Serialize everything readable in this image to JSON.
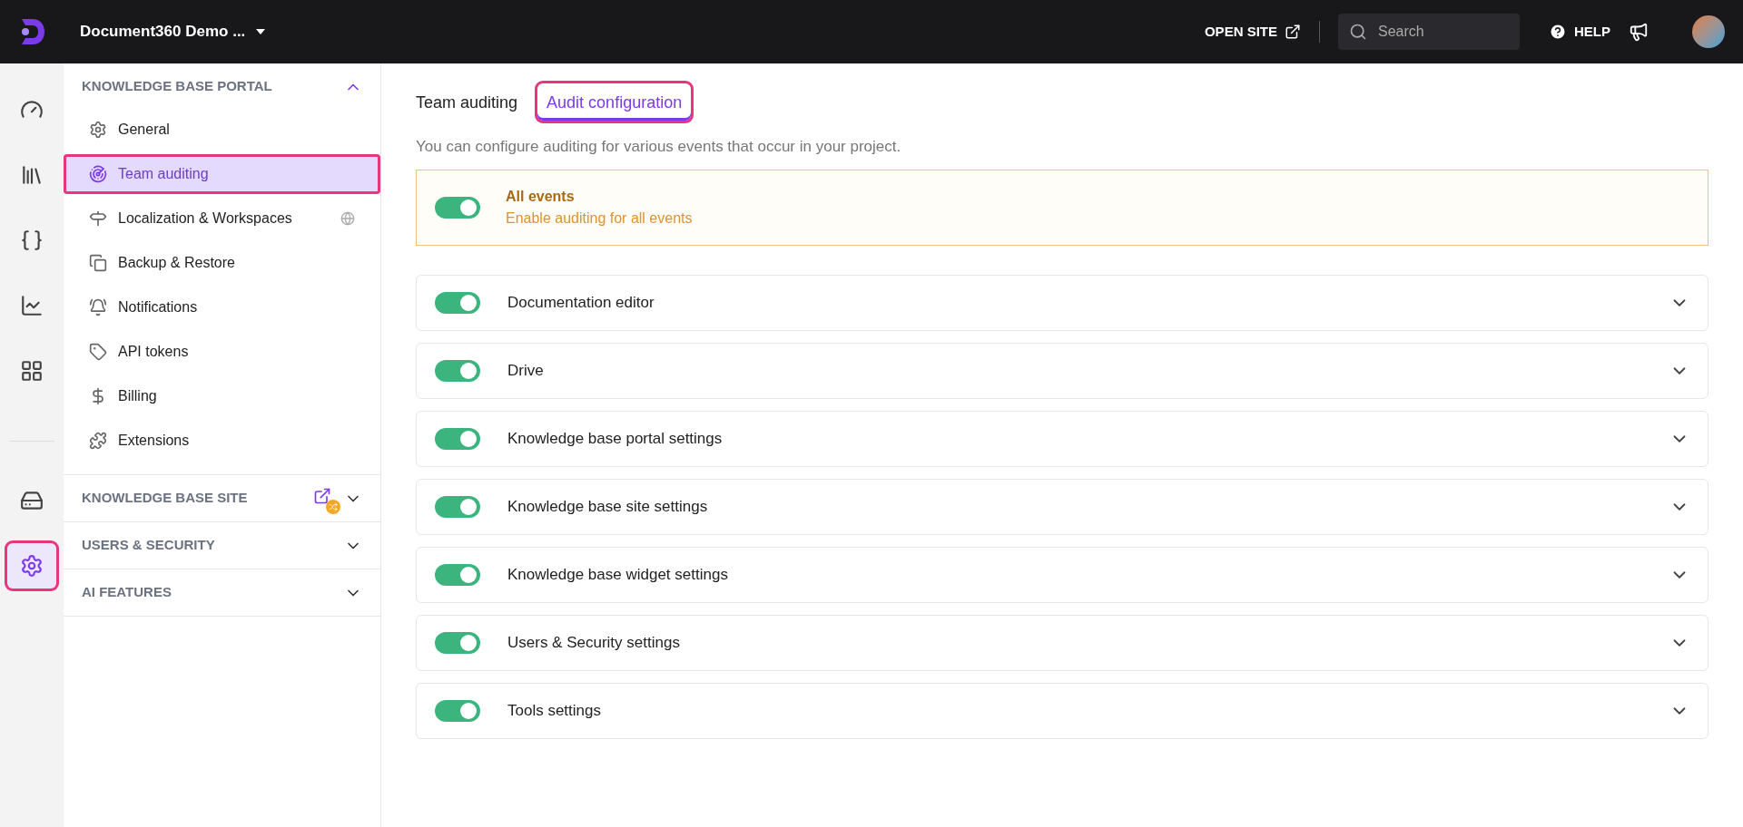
{
  "topbar": {
    "project": "Document360 Demo ...",
    "open_site": "OPEN SITE",
    "search": {
      "placeholder": "Search"
    },
    "help": "HELP"
  },
  "rail": [
    {
      "selected": false
    },
    {
      "selected": false
    },
    {
      "selected": false
    },
    {
      "selected": false
    },
    {
      "selected": false
    },
    {
      "selected": false
    },
    {
      "selected": true
    }
  ],
  "nav": [
    {
      "title": "KNOWLEDGE BASE PORTAL",
      "expanded": true,
      "items": [
        {
          "label": "General",
          "selected": false
        },
        {
          "label": "Team auditing",
          "selected": true
        },
        {
          "label": "Localization & Workspaces",
          "selected": false
        },
        {
          "label": "Backup & Restore",
          "selected": false
        },
        {
          "label": "Notifications",
          "selected": false
        },
        {
          "label": "API tokens",
          "selected": false
        },
        {
          "label": "Billing",
          "selected": false
        },
        {
          "label": "Extensions",
          "selected": false
        }
      ]
    },
    {
      "title": "KNOWLEDGE BASE SITE",
      "expanded": false
    },
    {
      "title": "USERS & SECURITY",
      "expanded": false
    },
    {
      "title": "AI FEATURES",
      "expanded": false
    }
  ],
  "tabs": [
    {
      "label": "Team auditing",
      "selected": false
    },
    {
      "label": "Audit configuration",
      "selected": true
    }
  ],
  "description": "You can configure auditing for various events that occur in your project.",
  "all_events": {
    "title": "All events",
    "subtitle": "Enable auditing for all events",
    "on": true
  },
  "categories": [
    {
      "label": "Documentation editor",
      "on": true
    },
    {
      "label": "Drive",
      "on": true
    },
    {
      "label": "Knowledge base portal settings",
      "on": true
    },
    {
      "label": "Knowledge base site settings",
      "on": true
    },
    {
      "label": "Knowledge base widget settings",
      "on": true
    },
    {
      "label": "Users & Security settings",
      "on": true
    },
    {
      "label": "Tools settings",
      "on": true
    }
  ]
}
